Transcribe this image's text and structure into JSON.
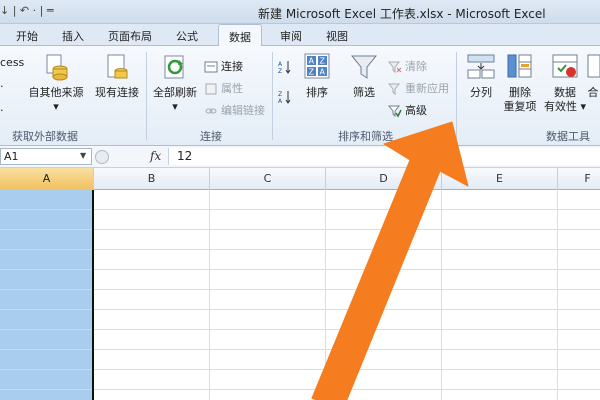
{
  "titlebar": {
    "qat": "↓ | ↶ · | ═",
    "title": "新建 Microsoft Excel 工作表.xlsx - Microsoft Excel"
  },
  "tabs": [
    "开始",
    "插入",
    "页面布局",
    "公式",
    "数据",
    "审阅",
    "视图"
  ],
  "active_tab": "数据",
  "ribbon": {
    "external": {
      "partial_label": "cess",
      "other_sources": "自其他来源",
      "existing": "现有连接",
      "group_label": "获取外部数据"
    },
    "connections": {
      "refresh_all": "全部刷新",
      "connect": "连接",
      "properties": "属性",
      "edit_links": "编辑链接",
      "group_label": "连接"
    },
    "sort_filter": {
      "sort": "排序",
      "filter": "筛选",
      "clear": "清除",
      "reapply": "重新应用",
      "advanced": "高级",
      "group_label": "排序和筛选"
    },
    "data_tools": {
      "split": "分列",
      "remove_dup_1": "删除",
      "remove_dup_2": "重复项",
      "validation_1": "数据",
      "validation_2": "有效性 ▾",
      "partial_he": "合",
      "group_label": "数据工具"
    }
  },
  "formulabar": {
    "namebox": "A1",
    "fx": "fx",
    "value": "12"
  },
  "grid": {
    "columns": [
      "A",
      "B",
      "C",
      "D",
      "E",
      "F"
    ],
    "selected_column": "A"
  },
  "colors": {
    "selection_fill": "#a8cdef",
    "arrow": "#f57d1f"
  }
}
